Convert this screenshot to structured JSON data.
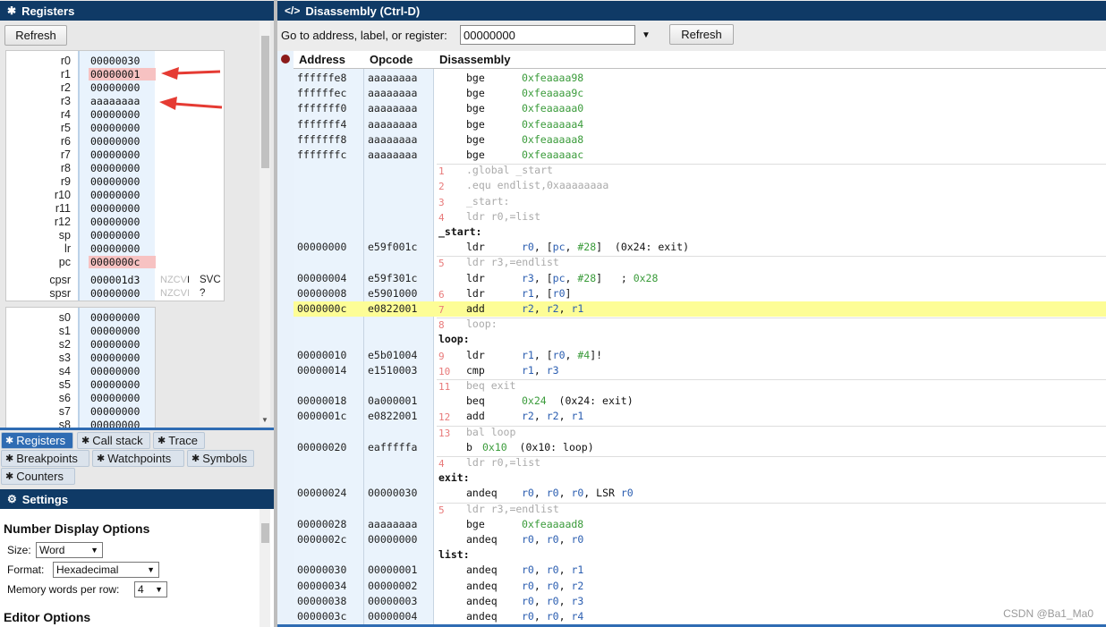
{
  "registers_panel": {
    "title": "Registers",
    "refresh_label": "Refresh",
    "core": [
      {
        "name": "r0",
        "value": "00000030",
        "highlight": false
      },
      {
        "name": "r1",
        "value": "00000001",
        "highlight": true
      },
      {
        "name": "r2",
        "value": "00000000",
        "highlight": false
      },
      {
        "name": "r3",
        "value": "aaaaaaaa",
        "highlight": false
      },
      {
        "name": "r4",
        "value": "00000000",
        "highlight": false
      },
      {
        "name": "r5",
        "value": "00000000",
        "highlight": false
      },
      {
        "name": "r6",
        "value": "00000000",
        "highlight": false
      },
      {
        "name": "r7",
        "value": "00000000",
        "highlight": false
      },
      {
        "name": "r8",
        "value": "00000000",
        "highlight": false
      },
      {
        "name": "r9",
        "value": "00000000",
        "highlight": false
      },
      {
        "name": "r10",
        "value": "00000000",
        "highlight": false
      },
      {
        "name": "r11",
        "value": "00000000",
        "highlight": false
      },
      {
        "name": "r12",
        "value": "00000000",
        "highlight": false
      },
      {
        "name": "sp",
        "value": "00000000",
        "highlight": false
      },
      {
        "name": "lr",
        "value": "00000000",
        "highlight": false
      },
      {
        "name": "pc",
        "value": "0000000c",
        "highlight": true
      }
    ],
    "status": [
      {
        "name": "cpsr",
        "value": "000001d3",
        "flags_off": "NZCV",
        "flags_on": "I",
        "mode": "SVC"
      },
      {
        "name": "spsr",
        "value": "00000000",
        "flags_off": "NZCVI",
        "flags_on": "",
        "mode": "?"
      }
    ],
    "vfp": [
      {
        "name": "s0",
        "value": "00000000"
      },
      {
        "name": "s1",
        "value": "00000000"
      },
      {
        "name": "s2",
        "value": "00000000"
      },
      {
        "name": "s3",
        "value": "00000000"
      },
      {
        "name": "s4",
        "value": "00000000"
      },
      {
        "name": "s5",
        "value": "00000000"
      },
      {
        "name": "s6",
        "value": "00000000"
      },
      {
        "name": "s7",
        "value": "00000000"
      },
      {
        "name": "s8",
        "value": "00000000"
      }
    ],
    "annotation_color": "#e53b33",
    "highlight_color": "#f7c2c2"
  },
  "tabs": [
    {
      "label": "Registers",
      "active": true
    },
    {
      "label": "Call stack",
      "active": false
    },
    {
      "label": "Trace",
      "active": false
    },
    {
      "label": "Breakpoints",
      "active": false
    },
    {
      "label": "Watchpoints",
      "active": false
    },
    {
      "label": "Symbols",
      "active": false
    },
    {
      "label": "Counters",
      "active": false
    }
  ],
  "settings": {
    "title": "Settings",
    "number_display_title": "Number Display Options",
    "size_label": "Size:",
    "size_value": "Word",
    "format_label": "Format:",
    "format_value": "Hexadecimal",
    "words_label": "Memory words per row:",
    "words_value": "4",
    "editor_title": "Editor Options"
  },
  "disassembly": {
    "title": "Disassembly (Ctrl-D)",
    "goto_label": "Go to address, label, or register:",
    "goto_value": "00000000",
    "refresh_label": "Refresh",
    "headers": {
      "address": "Address",
      "opcode": "Opcode",
      "disassembly": "Disassembly"
    },
    "current_line_color": "#fdfd96",
    "rows": [
      {
        "kind": "ins",
        "addr": "ffffffe8",
        "op": "aaaaaaaa",
        "mn": "bge",
        "ops": [
          [
            "0xfeaaaa98",
            "num"
          ]
        ]
      },
      {
        "kind": "ins",
        "addr": "ffffffec",
        "op": "aaaaaaaa",
        "mn": "bge",
        "ops": [
          [
            "0xfeaaaa9c",
            "num"
          ]
        ]
      },
      {
        "kind": "ins",
        "addr": "fffffff0",
        "op": "aaaaaaaa",
        "mn": "bge",
        "ops": [
          [
            "0xfeaaaaa0",
            "num"
          ]
        ]
      },
      {
        "kind": "ins",
        "addr": "fffffff4",
        "op": "aaaaaaaa",
        "mn": "bge",
        "ops": [
          [
            "0xfeaaaaa4",
            "num"
          ]
        ]
      },
      {
        "kind": "ins",
        "addr": "fffffff8",
        "op": "aaaaaaaa",
        "mn": "bge",
        "ops": [
          [
            "0xfeaaaaa8",
            "num"
          ]
        ]
      },
      {
        "kind": "ins",
        "addr": "fffffffc",
        "op": "aaaaaaaa",
        "mn": "bge",
        "ops": [
          [
            "0xfeaaaaac",
            "num"
          ]
        ]
      },
      {
        "kind": "src",
        "ln": "1",
        "text": ".global _start",
        "sep": true
      },
      {
        "kind": "src",
        "ln": "2",
        "text": ".equ endlist,0xaaaaaaaa"
      },
      {
        "kind": "src",
        "ln": "3",
        "text": "_start:"
      },
      {
        "kind": "src",
        "ln": "4",
        "text": "ldr r0,=list"
      },
      {
        "kind": "label",
        "text": "_start:"
      },
      {
        "kind": "ins",
        "addr": "00000000",
        "op": "e59f001c",
        "mn": "ldr",
        "ops": [
          [
            "r0",
            "reg"
          ],
          [
            ", [",
            "txt"
          ],
          [
            "pc",
            "reg"
          ],
          [
            ", ",
            "txt"
          ],
          [
            "#28",
            "num"
          ],
          [
            "]  (0x24: exit)",
            "txt"
          ]
        ]
      },
      {
        "kind": "src",
        "ln": "5",
        "text": "ldr r3,=endlist",
        "sep": true
      },
      {
        "kind": "ins",
        "addr": "00000004",
        "op": "e59f301c",
        "mn": "ldr",
        "ops": [
          [
            "r3",
            "reg"
          ],
          [
            ", [",
            "txt"
          ],
          [
            "pc",
            "reg"
          ],
          [
            ", ",
            "txt"
          ],
          [
            "#28",
            "num"
          ],
          [
            "]   ; ",
            "txt"
          ],
          [
            "0x28",
            "num"
          ]
        ]
      },
      {
        "kind": "ins",
        "addr": "00000008",
        "op": "e5901000",
        "ln": "6",
        "mn": "ldr",
        "ops": [
          [
            "r1",
            "reg"
          ],
          [
            ", [",
            "txt"
          ],
          [
            "r0",
            "reg"
          ],
          [
            "]",
            "txt"
          ]
        ]
      },
      {
        "kind": "ins",
        "addr": "0000000c",
        "op": "e0822001",
        "ln": "7",
        "mn": "add",
        "hl": true,
        "ops": [
          [
            "r2",
            "reg"
          ],
          [
            ", ",
            "txt"
          ],
          [
            "r2",
            "reg"
          ],
          [
            ", ",
            "txt"
          ],
          [
            "r1",
            "reg"
          ]
        ]
      },
      {
        "kind": "src",
        "ln": "8",
        "text": "loop:",
        "sep": true
      },
      {
        "kind": "label",
        "text": "loop:"
      },
      {
        "kind": "ins",
        "addr": "00000010",
        "op": "e5b01004",
        "ln": "9",
        "mn": "ldr",
        "ops": [
          [
            "r1",
            "reg"
          ],
          [
            ", [",
            "txt"
          ],
          [
            "r0",
            "reg"
          ],
          [
            ", ",
            "txt"
          ],
          [
            "#4",
            "num"
          ],
          [
            "]!",
            "txt"
          ]
        ]
      },
      {
        "kind": "ins",
        "addr": "00000014",
        "op": "e1510003",
        "ln": "10",
        "mn": "cmp",
        "ops": [
          [
            "r1",
            "reg"
          ],
          [
            ", ",
            "txt"
          ],
          [
            "r3",
            "reg"
          ]
        ]
      },
      {
        "kind": "src",
        "ln": "11",
        "text": "beq exit",
        "sep": true
      },
      {
        "kind": "ins",
        "addr": "00000018",
        "op": "0a000001",
        "mn": "beq",
        "ops": [
          [
            "0x24",
            "num"
          ],
          [
            "  (0x24: exit)",
            "txt"
          ]
        ]
      },
      {
        "kind": "ins",
        "addr": "0000001c",
        "op": "e0822001",
        "ln": "12",
        "mn": "add",
        "ops": [
          [
            "r2",
            "reg"
          ],
          [
            ", ",
            "txt"
          ],
          [
            "r2",
            "reg"
          ],
          [
            ", ",
            "txt"
          ],
          [
            "r1",
            "reg"
          ]
        ]
      },
      {
        "kind": "src",
        "ln": "13",
        "text": "bal loop",
        "sep": true
      },
      {
        "kind": "ins",
        "addr": "00000020",
        "op": "eafffffa",
        "mn": "b",
        "opsShift": true,
        "ops": [
          [
            "0x10",
            "num"
          ],
          [
            "  (0x10: loop)",
            "txt"
          ]
        ]
      },
      {
        "kind": "src",
        "ln": "4",
        "text": "ldr r0,=list",
        "sep": true
      },
      {
        "kind": "label",
        "text": "exit:"
      },
      {
        "kind": "ins",
        "addr": "00000024",
        "op": "00000030",
        "mn": "andeq",
        "ops": [
          [
            "r0",
            "reg"
          ],
          [
            ", ",
            "txt"
          ],
          [
            "r0",
            "reg"
          ],
          [
            ", ",
            "txt"
          ],
          [
            "r0",
            "reg"
          ],
          [
            ", LSR ",
            "txt"
          ],
          [
            "r0",
            "reg"
          ]
        ]
      },
      {
        "kind": "src",
        "ln": "5",
        "text": "ldr r3,=endlist",
        "sep": true
      },
      {
        "kind": "ins",
        "addr": "00000028",
        "op": "aaaaaaaa",
        "mn": "bge",
        "ops": [
          [
            "0xfeaaaad8",
            "num"
          ]
        ]
      },
      {
        "kind": "ins",
        "addr": "0000002c",
        "op": "00000000",
        "mn": "andeq",
        "ops": [
          [
            "r0",
            "reg"
          ],
          [
            ", ",
            "txt"
          ],
          [
            "r0",
            "reg"
          ],
          [
            ", ",
            "txt"
          ],
          [
            "r0",
            "reg"
          ]
        ]
      },
      {
        "kind": "label",
        "text": "list:"
      },
      {
        "kind": "ins",
        "addr": "00000030",
        "op": "00000001",
        "mn": "andeq",
        "ops": [
          [
            "r0",
            "reg"
          ],
          [
            ", ",
            "txt"
          ],
          [
            "r0",
            "reg"
          ],
          [
            ", ",
            "txt"
          ],
          [
            "r1",
            "reg"
          ]
        ]
      },
      {
        "kind": "ins",
        "addr": "00000034",
        "op": "00000002",
        "mn": "andeq",
        "ops": [
          [
            "r0",
            "reg"
          ],
          [
            ", ",
            "txt"
          ],
          [
            "r0",
            "reg"
          ],
          [
            ", ",
            "txt"
          ],
          [
            "r2",
            "reg"
          ]
        ]
      },
      {
        "kind": "ins",
        "addr": "00000038",
        "op": "00000003",
        "mn": "andeq",
        "ops": [
          [
            "r0",
            "reg"
          ],
          [
            ", ",
            "txt"
          ],
          [
            "r0",
            "reg"
          ],
          [
            ", ",
            "txt"
          ],
          [
            "r3",
            "reg"
          ]
        ]
      },
      {
        "kind": "ins",
        "addr": "0000003c",
        "op": "00000004",
        "mn": "andeq",
        "ops": [
          [
            "r0",
            "reg"
          ],
          [
            ", ",
            "txt"
          ],
          [
            "r0",
            "reg"
          ],
          [
            ", ",
            "txt"
          ],
          [
            "r4",
            "reg"
          ]
        ]
      }
    ]
  },
  "watermark": "CSDN @Ba1_Ma0"
}
